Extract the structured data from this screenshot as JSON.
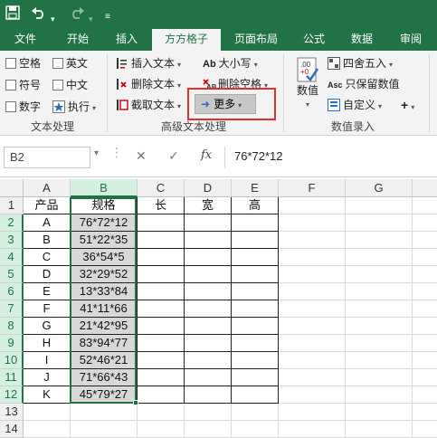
{
  "quick_access": {
    "save_icon": "save-icon",
    "undo_icon": "undo-icon",
    "redo_icon": "redo-icon",
    "customize_icon": "customize-qa-icon"
  },
  "tabs": [
    "文件",
    "开始",
    "插入",
    "方方格子",
    "页面布局",
    "公式",
    "数据",
    "审阅"
  ],
  "active_tab": "方方格子",
  "ribbon": {
    "text_group": {
      "label": "文本处理",
      "checkboxes": [
        "空格",
        "英文",
        "符号",
        "中文",
        "数字"
      ],
      "execute": "执行"
    },
    "advanced_group": {
      "label": "高级文本处理",
      "insert_text": "插入文本",
      "delete_text": "删除文本",
      "extract_text": "截取文本",
      "case": "大小写",
      "delete_space": "删除空格",
      "more": "更多"
    },
    "number_group": {
      "label": "数值录入",
      "value": "数值",
      "round": "四舍五入",
      "keep_value": "只保留数值",
      "custom": "自定义"
    }
  },
  "formula_bar": {
    "name_box": "B2",
    "fx": "fx",
    "formula": "76*72*12"
  },
  "columns": [
    "A",
    "B",
    "C",
    "D",
    "E",
    "F",
    "G"
  ],
  "rows": [
    "1",
    "2",
    "3",
    "4",
    "5",
    "6",
    "7",
    "8",
    "9",
    "10",
    "11",
    "12",
    "13",
    "14"
  ],
  "header_row": [
    "产品",
    "规格",
    "长",
    "宽",
    "高"
  ],
  "data_rows": [
    [
      "A",
      "76*72*12"
    ],
    [
      "B",
      "51*22*35"
    ],
    [
      "C",
      "36*54*5"
    ],
    [
      "D",
      "32*29*52"
    ],
    [
      "E",
      "13*33*84"
    ],
    [
      "F",
      "41*11*66"
    ],
    [
      "G",
      "21*42*95"
    ],
    [
      "H",
      "83*94*77"
    ],
    [
      "I",
      "52*46*21"
    ],
    [
      "J",
      "71*66*43"
    ],
    [
      "K",
      "45*79*27"
    ]
  ],
  "accent_color": "#217346",
  "highlight_color": "#e03030"
}
